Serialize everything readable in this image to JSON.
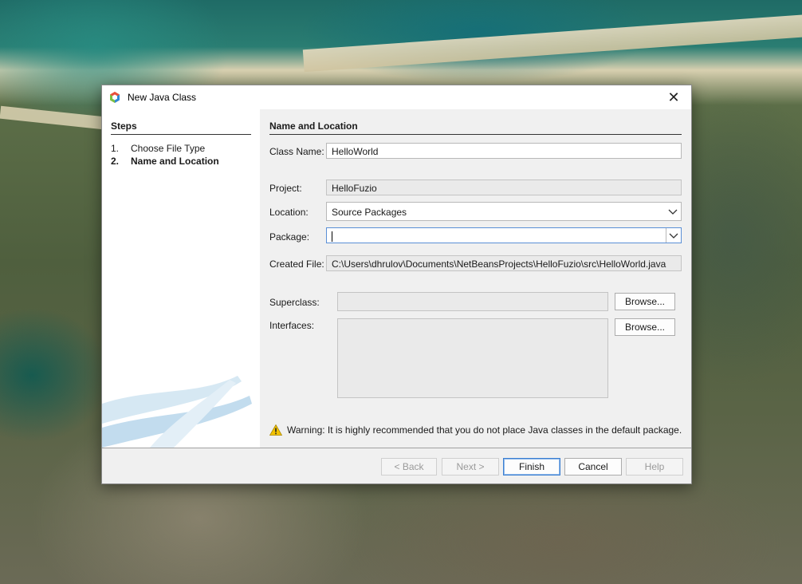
{
  "window": {
    "title": "New Java Class",
    "close_glyph": "✕"
  },
  "steps": {
    "title": "Steps",
    "items": [
      {
        "num": "1.",
        "label": "Choose File Type"
      },
      {
        "num": "2.",
        "label": "Name and Location"
      }
    ]
  },
  "form": {
    "section_title": "Name and Location",
    "class_name_label": "Class Name:",
    "class_name_value": "HelloWorld",
    "project_label": "Project:",
    "project_value": "HelloFuzio",
    "location_label": "Location:",
    "location_value": "Source Packages",
    "package_label": "Package:",
    "package_value": "",
    "created_file_label": "Created File:",
    "created_file_value": "C:\\Users\\dhrulov\\Documents\\NetBeansProjects\\HelloFuzio\\src\\HelloWorld.java",
    "superclass_label": "Superclass:",
    "superclass_value": "",
    "interfaces_label": "Interfaces:",
    "browse_label": "Browse...",
    "warning_text": "Warning: It is highly recommended that you do not place Java classes in the default package."
  },
  "buttons": {
    "back": "< Back",
    "next": "Next >",
    "finish": "Finish",
    "cancel": "Cancel",
    "help": "Help"
  },
  "icons": {
    "app": "netbeans-cube-icon",
    "warning": "warning-triangle-icon",
    "dropdown": "chevron-down-icon"
  },
  "colors": {
    "focus_border": "#5a8fd6",
    "primary_button_border": "#3c7fd1",
    "warning_yellow": "#f2c200"
  }
}
